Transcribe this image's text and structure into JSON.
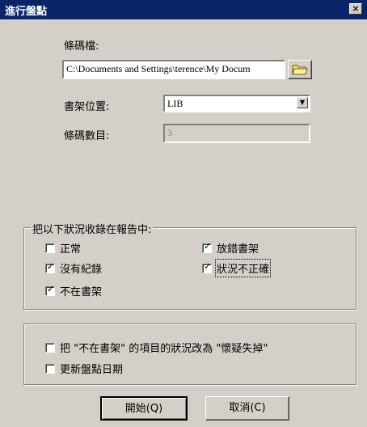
{
  "window": {
    "title": "進行盤點",
    "close": "×"
  },
  "barcode_file": {
    "label": "條碼檔:",
    "value": "C:\\Documents and Settings\\terence\\My Docum"
  },
  "shelf": {
    "label": "書架位置:",
    "value": "LIB"
  },
  "count": {
    "label": "條碼數目:",
    "value": "3"
  },
  "report_group": {
    "title": "把以下狀況收錄在報告中:",
    "items": [
      {
        "label": "正常",
        "checked": false
      },
      {
        "label": "放錯書架",
        "checked": true
      },
      {
        "label": "沒有紀錄",
        "checked": true
      },
      {
        "label": "狀況不正確",
        "checked": true
      },
      {
        "label": "不在書架",
        "checked": true
      }
    ]
  },
  "options": {
    "items": [
      {
        "label": "把 \"不在書架\" 的項目的狀況改為 \"懷疑失掉\"",
        "checked": false
      },
      {
        "label": "更新盤點日期",
        "checked": false
      }
    ]
  },
  "buttons": {
    "start": "開始(Q)",
    "cancel": "取消(C)"
  },
  "icons": {
    "close": "close-icon",
    "folder": "folder-icon",
    "dropdown": "chevron-down-icon",
    "check": "✓"
  }
}
